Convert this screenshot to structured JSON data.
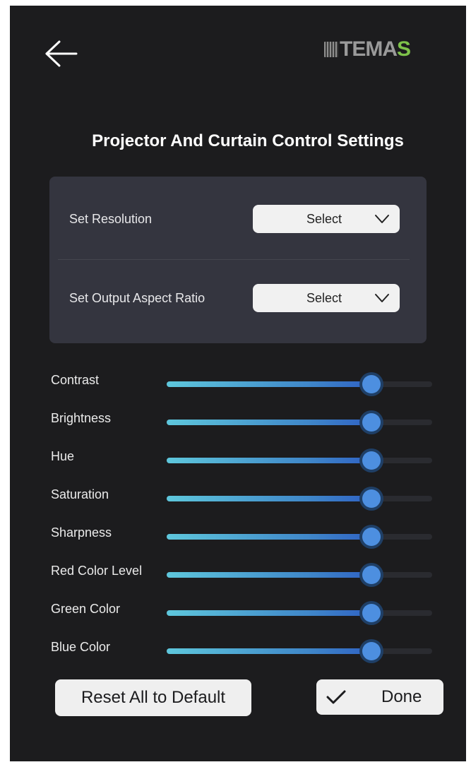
{
  "header": {
    "back_icon": "arrow-left-icon",
    "logo_text_main": "TEMA",
    "logo_text_accent": "S",
    "logo_accent_color": "#7ec24a"
  },
  "page": {
    "title": "Projector And Curtain Control Settings"
  },
  "settings_card": {
    "resolution": {
      "label": "Set Resolution",
      "value": "Select"
    },
    "aspect_ratio": {
      "label": "Set Output Aspect Ratio",
      "value": "Select"
    }
  },
  "sliders": [
    {
      "label": "Contrast",
      "value": 0.77
    },
    {
      "label": "Brightness",
      "value": 0.77
    },
    {
      "label": "Hue",
      "value": 0.77
    },
    {
      "label": "Saturation",
      "value": 0.77
    },
    {
      "label": "Sharpness",
      "value": 0.77
    },
    {
      "label": "Red Color Level",
      "value": 0.77
    },
    {
      "label": "Green Color",
      "value": 0.77
    },
    {
      "label": "Blue Color",
      "value": 0.77
    }
  ],
  "actions": {
    "reset_label": "Reset All to Default",
    "done_label": "Done"
  },
  "colors": {
    "background": "#1c1c1e",
    "card": "#34353f",
    "slider_thumb": "#4d8fe0"
  }
}
